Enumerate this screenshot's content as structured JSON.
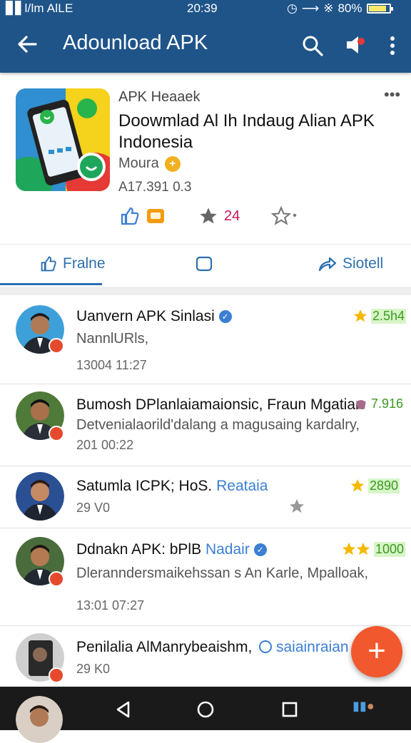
{
  "status": {
    "left": "▊▋l/lm AlLE",
    "time": "20:39",
    "battery": "80%"
  },
  "appbar": {
    "title": "Adounload APK"
  },
  "app": {
    "subtitle": "APK Heaaek",
    "title": "Doowmlad Al Ih Indaug Alian APK Indonesia",
    "developer": "Moura",
    "meta": "A17.391  0.3",
    "rating_count": "24"
  },
  "tabs": [
    {
      "label": "Fralne"
    },
    {
      "label": ""
    },
    {
      "label": "Siotell"
    }
  ],
  "reviews": [
    {
      "name": "Uanvern APK Sinlasi",
      "line2": "NannlURls,",
      "line3": "13004   11:27",
      "score": "2.5һ4",
      "verified": true
    },
    {
      "name": "Bumosh DPlanlaiamaionsic, Fraun Mgatian",
      "line2": "Detvenialaorild'dalang a magusaing kardalry,",
      "line3": "201   00:22",
      "score": "7.916",
      "verified": false
    },
    {
      "name": "Satumla ICPK; HoS.",
      "tag": "Reataia",
      "line2": "29 V0",
      "score": "2890",
      "verified": false
    },
    {
      "name": "Ddnakn APK: bPlB",
      "tag": "Nadair",
      "line2": "Dleranndersmaikehssan s An Karle, Mpalloak,",
      "line3": "13:01    07:27",
      "score": "1000",
      "verified": true
    },
    {
      "name": "Penilalia AlManrybeaishm,",
      "tag": "saiainraian",
      "line2": "29 K0",
      "verified": false
    }
  ],
  "fab": {
    "label": "+"
  },
  "colors": {
    "primary": "#1f5489",
    "accent": "#f2582d",
    "link": "#2b6fb0",
    "star": "#f5b800"
  }
}
